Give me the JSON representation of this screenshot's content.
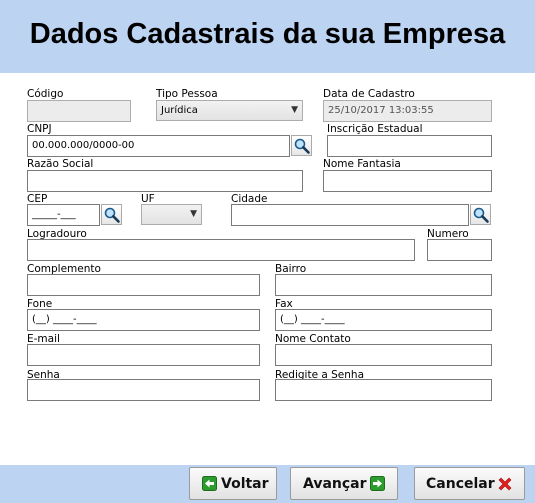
{
  "header": {
    "title": "Dados Cadastrais da sua Empresa"
  },
  "form": {
    "codigo": {
      "label": "Código",
      "value": ""
    },
    "tipo_pessoa": {
      "label": "Tipo Pessoa",
      "selected": "Jurídica"
    },
    "data_cadastro": {
      "label": "Data de Cadastro",
      "value": "25/10/2017 13:03:55"
    },
    "cnpj": {
      "label": "CNPJ",
      "value": "00.000.000/0000-00"
    },
    "inscricao_estadual": {
      "label": "Inscrição Estadual",
      "value": ""
    },
    "razao_social": {
      "label": "Razão Social",
      "value": ""
    },
    "nome_fantasia": {
      "label": "Nome Fantasia",
      "value": ""
    },
    "cep": {
      "label": "CEP",
      "value": "_____-___"
    },
    "uf": {
      "label": "UF",
      "selected": ""
    },
    "cidade": {
      "label": "Cidade",
      "value": ""
    },
    "logradouro": {
      "label": "Logradouro",
      "value": ""
    },
    "numero": {
      "label": "Numero",
      "value": ""
    },
    "complemento": {
      "label": "Complemento",
      "value": ""
    },
    "bairro": {
      "label": "Bairro",
      "value": ""
    },
    "fone": {
      "label": "Fone",
      "value": "(__) ____-____"
    },
    "fax": {
      "label": "Fax",
      "value": "(__) ____-____"
    },
    "email": {
      "label": "E-mail",
      "value": ""
    },
    "nome_contato": {
      "label": "Nome Contato",
      "value": ""
    },
    "senha": {
      "label": "Senha",
      "value": ""
    },
    "redigite_senha": {
      "label": "Redigite a Senha",
      "value": ""
    }
  },
  "footer": {
    "voltar_label": "Voltar",
    "avancar_label": "Avançar",
    "cancelar_label": "Cancelar"
  },
  "colors": {
    "header_bg": "#bcd3f2",
    "back_icon": "#2e9b2e",
    "cancel_icon": "#e02020"
  }
}
